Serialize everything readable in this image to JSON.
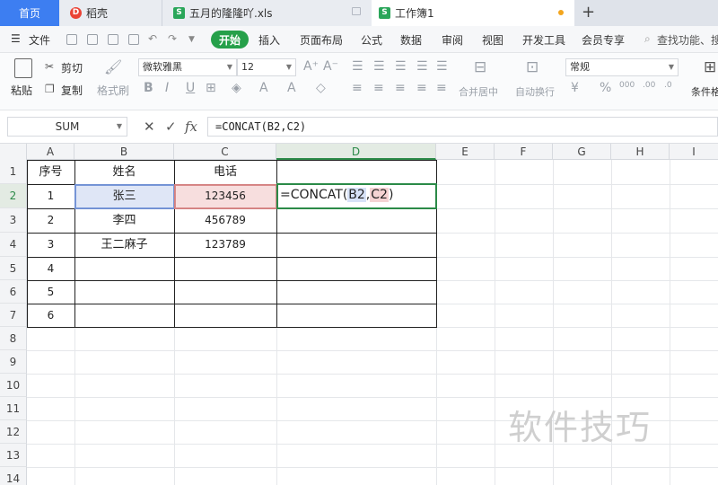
{
  "tabs": {
    "home": "首页",
    "docer": "稻壳",
    "file1": "五月的隆隆吖.xls",
    "active": "工作簿1",
    "new_tab": "+"
  },
  "menu": {
    "file": "文件",
    "items": [
      "开始",
      "插入",
      "页面布局",
      "公式",
      "数据",
      "审阅",
      "视图",
      "开发工具",
      "会员专享"
    ],
    "search": "查找功能、搜"
  },
  "ribbon": {
    "paste": "粘贴",
    "cut": "剪切",
    "copy": "复制",
    "format_painter": "格式刷",
    "font_name": "微软雅黑",
    "font_size": "12",
    "merge_center": "合并居中",
    "auto_wrap": "自动换行",
    "number_format": "常规",
    "conditional": "条件格"
  },
  "formula_bar": {
    "name_box": "SUM",
    "fx": "fx",
    "formula": "=CONCAT(B2,C2)"
  },
  "columns": [
    "A",
    "B",
    "C",
    "D",
    "E",
    "F",
    "G",
    "H",
    "I"
  ],
  "rows": [
    "1",
    "2",
    "3",
    "4",
    "5",
    "6",
    "7",
    "8",
    "9",
    "10",
    "11",
    "12",
    "13",
    "14"
  ],
  "selected": {
    "column": "D",
    "row": "2"
  },
  "table": {
    "headers": [
      "序号",
      "姓名",
      "电话"
    ],
    "rows": [
      [
        "1",
        "张三",
        "123456"
      ],
      [
        "2",
        "李四",
        "456789"
      ],
      [
        "3",
        "王二麻子",
        "123789"
      ],
      [
        "4",
        "",
        ""
      ],
      [
        "5",
        "",
        ""
      ],
      [
        "6",
        "",
        ""
      ]
    ]
  },
  "editing_cell": {
    "prefix": "=CONCAT(",
    "ref1": "B2",
    "sep": ",",
    "ref2": "C2",
    "suffix": ")"
  },
  "watermark": "软件技巧",
  "colors": {
    "accent_green": "#26a04a",
    "home_tab_blue": "#3d7ef1",
    "ref_blue": "#dfe6f6",
    "ref_red": "#f7dede"
  }
}
